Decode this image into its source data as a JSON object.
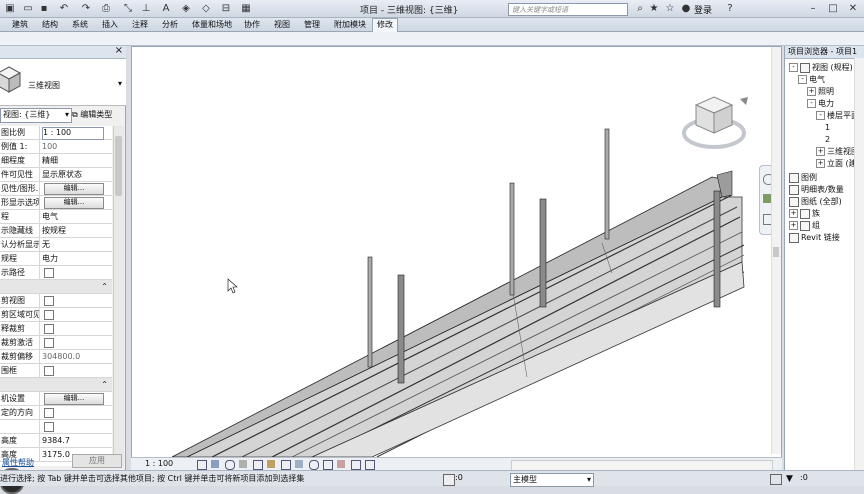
{
  "title_bar": {
    "document_title": "项目 - 三维视图: {三维}",
    "search_placeholder": "键入关键字或短语",
    "login_label": "登录",
    "quick_access_icons": [
      "open-icon",
      "save-icon",
      "undo-icon",
      "redo-icon",
      "print-icon",
      "measure-icon",
      "text-icon",
      "view-3d-icon"
    ]
  },
  "ribbon": {
    "tabs": [
      "建筑",
      "结构",
      "系统",
      "插入",
      "注释",
      "分析",
      "体量和场地",
      "协作",
      "视图",
      "管理",
      "附加模块",
      "修改"
    ],
    "active_tab": "修改"
  },
  "properties": {
    "type_name": "三维视图",
    "view_dropdown": "视图: {三维}",
    "edit_type_label": "编辑类型",
    "rows": [
      {
        "k": "图比例",
        "v": "1 : 100",
        "kind": "input"
      },
      {
        "k": "例值 1:",
        "v": "100",
        "kind": "grey"
      },
      {
        "k": "细程度",
        "v": "精细",
        "kind": "text"
      },
      {
        "k": "件可见性",
        "v": "显示原状态",
        "kind": "text"
      },
      {
        "k": "见性/图形...",
        "v": "编辑...",
        "kind": "button"
      },
      {
        "k": "形显示选项",
        "v": "编辑...",
        "kind": "button"
      },
      {
        "k": "程",
        "v": "电气",
        "kind": "text"
      },
      {
        "k": "示隐藏线",
        "v": "按规程",
        "kind": "text"
      },
      {
        "k": "认分析显示...",
        "v": "无",
        "kind": "text"
      },
      {
        "k": "规程",
        "v": "电力",
        "kind": "text"
      },
      {
        "k": "示路径",
        "v": "",
        "kind": "check"
      },
      {
        "k": "",
        "v": "",
        "kind": "section"
      },
      {
        "k": "剪视图",
        "v": "",
        "kind": "check"
      },
      {
        "k": "剪区域可见",
        "v": "",
        "kind": "check"
      },
      {
        "k": "释裁剪",
        "v": "",
        "kind": "check"
      },
      {
        "k": "裁剪激活",
        "v": "",
        "kind": "check"
      },
      {
        "k": "裁剪偏移",
        "v": "304800.0",
        "kind": "grey"
      },
      {
        "k": "围框",
        "v": "",
        "kind": "check"
      },
      {
        "k": "",
        "v": "",
        "kind": "section"
      },
      {
        "k": "机设置",
        "v": "编辑...",
        "kind": "button"
      },
      {
        "k": "定的方向",
        "v": "",
        "kind": "check"
      },
      {
        "k": "",
        "v": "",
        "kind": "check"
      },
      {
        "k": "高度",
        "v": "9384.7",
        "kind": "text"
      },
      {
        "k": "高度",
        "v": "3175.0",
        "kind": "text"
      }
    ],
    "help_link": "属性帮助",
    "apply_label": "应用"
  },
  "view_control": {
    "scale": "1 : 100"
  },
  "project_browser": {
    "header": "项目浏览器 - 项目1",
    "nodes": [
      {
        "label": "视图 (规程)",
        "level": 0,
        "toggle": "-",
        "icon": true
      },
      {
        "label": "电气",
        "level": 1,
        "toggle": "-",
        "icon": false
      },
      {
        "label": "照明",
        "level": 2,
        "toggle": "+",
        "icon": false
      },
      {
        "label": "电力",
        "level": 2,
        "toggle": "-",
        "icon": false
      },
      {
        "label": "楼层平面",
        "level": 3,
        "toggle": "-",
        "icon": false
      },
      {
        "label": "1",
        "level": 4,
        "toggle": "",
        "icon": false
      },
      {
        "label": "2",
        "level": 4,
        "toggle": "",
        "icon": false
      },
      {
        "label": "三维视图",
        "level": 3,
        "toggle": "+",
        "icon": false
      },
      {
        "label": "立面 (建",
        "level": 3,
        "toggle": "+",
        "icon": false
      },
      {
        "label": "图例",
        "level": 0,
        "toggle": "",
        "icon": true
      },
      {
        "label": "明细表/数量",
        "level": 0,
        "toggle": "",
        "icon": true
      },
      {
        "label": "图纸 (全部)",
        "level": 0,
        "toggle": "",
        "icon": true
      },
      {
        "label": "族",
        "level": 0,
        "toggle": "+",
        "icon": true
      },
      {
        "label": "组",
        "level": 0,
        "toggle": "+",
        "icon": true
      },
      {
        "label": "Revit 链接",
        "level": 0,
        "toggle": "",
        "icon": true
      }
    ]
  },
  "status_bar": {
    "message": "进行选择; 按 Tab 键并单击可选择其他项目; 按 Ctrl 键并单击可将新项目添加到选择集",
    "workset_value": ":0",
    "model_dropdown": "主模型",
    "filter_value": ":0"
  },
  "colors": {
    "accent": "#1a4fa0",
    "panel": "#f0f0f0",
    "chrome": "#d9dde3"
  }
}
